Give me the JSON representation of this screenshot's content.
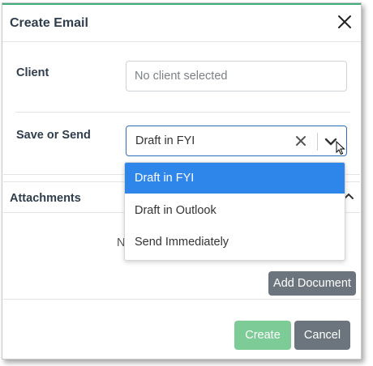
{
  "dialog": {
    "title": "Create Email"
  },
  "client": {
    "label": "Client",
    "placeholder": "No client selected",
    "value": ""
  },
  "save_send": {
    "label": "Save or Send",
    "selected": "Draft in FYI",
    "options": [
      "Draft in FYI",
      "Draft in Outlook",
      "Send Immediately"
    ]
  },
  "attachments": {
    "title": "Attachments",
    "empty_text_visible": "N",
    "add_button": "Add Document"
  },
  "footer": {
    "create_label": "Create",
    "cancel_label": "Cancel"
  },
  "colors": {
    "accent_top": "#3fae7a",
    "selected_option": "#2f86ea",
    "create_button": "#7dcc97",
    "secondary_button": "#6c757d"
  }
}
